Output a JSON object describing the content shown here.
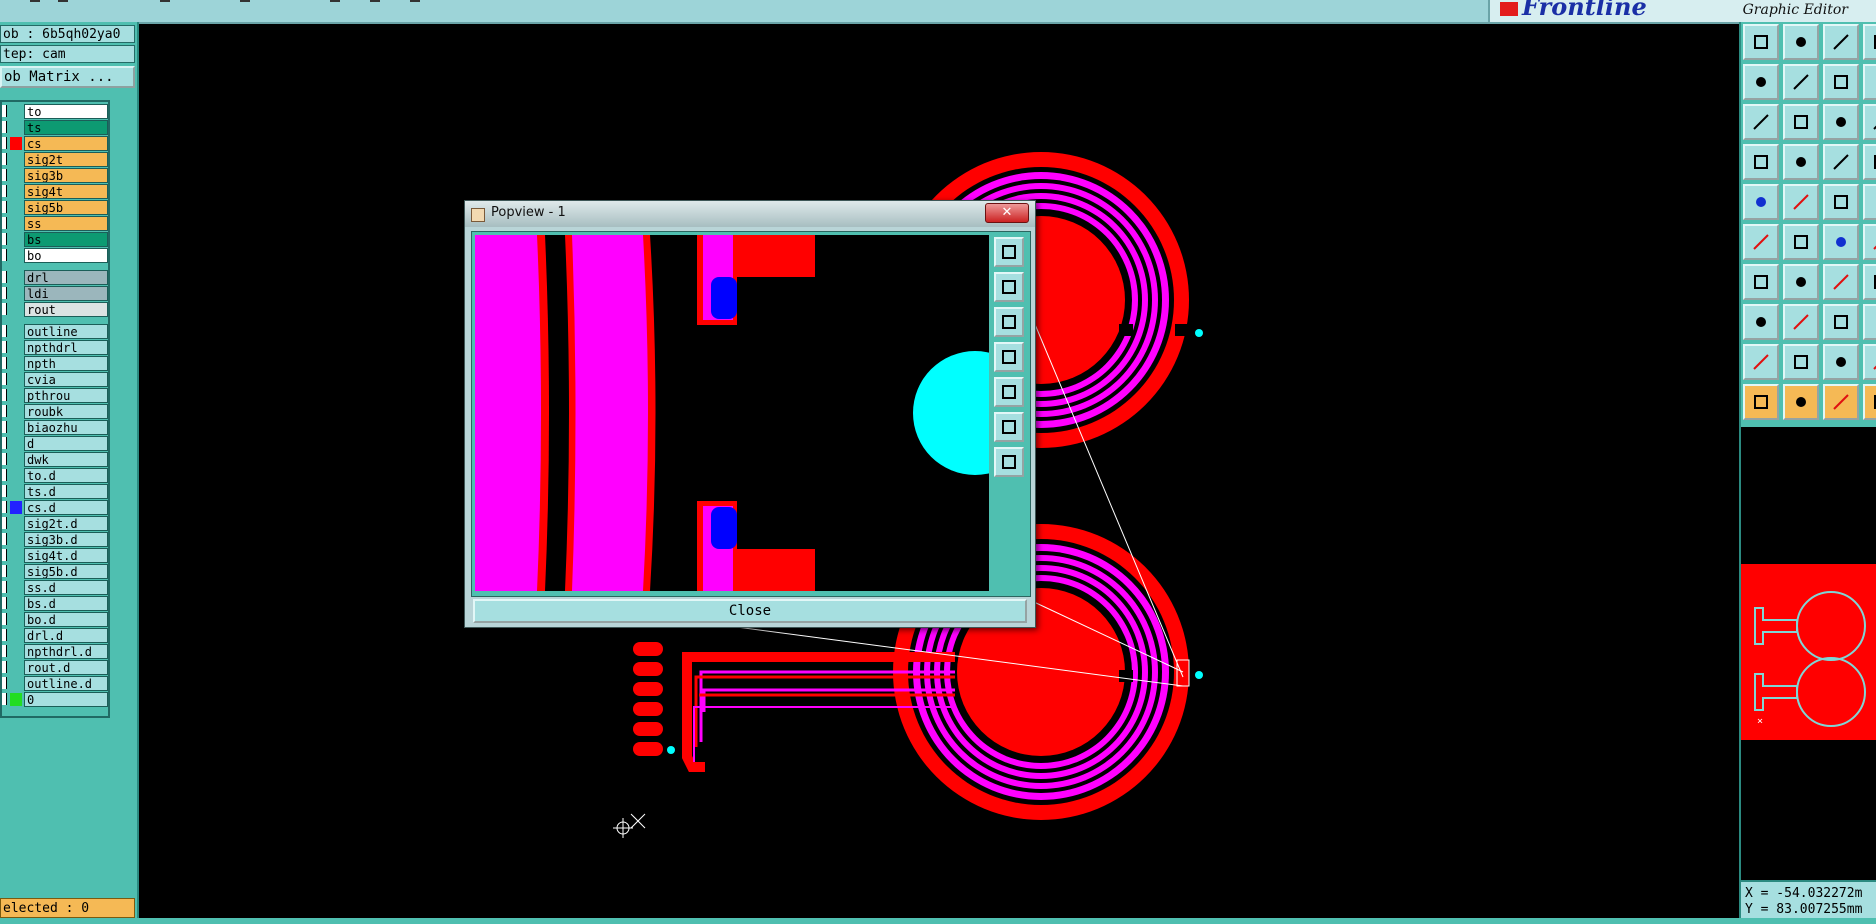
{
  "header": {
    "logo_text": "Frontline",
    "logo_subtitle": "Graphic Editor"
  },
  "left_panel": {
    "job_label": "ob : 6b5qh02ya0",
    "step_label": "tep: cam",
    "matrix_button": "ob Matrix ...",
    "layers": [
      {
        "name": "to",
        "color": "#ffffff"
      },
      {
        "name": "ts",
        "color": "#0d9a72"
      },
      {
        "name": "cs",
        "color": "#f5b955",
        "swatch": "#ff0000"
      },
      {
        "name": "sig2t",
        "color": "#f5b955"
      },
      {
        "name": "sig3b",
        "color": "#f5b955"
      },
      {
        "name": "sig4t",
        "color": "#f5b955"
      },
      {
        "name": "sig5b",
        "color": "#f5b955"
      },
      {
        "name": "ss",
        "color": "#f5b955"
      },
      {
        "name": "bs",
        "color": "#0d9a72"
      },
      {
        "name": "bo",
        "color": "#ffffff"
      },
      {
        "name": "drl",
        "color": "#9bb6bc"
      },
      {
        "name": "ldi",
        "color": "#9bb6bc"
      },
      {
        "name": "rout",
        "color": "#dbe3e3"
      },
      {
        "name": "outline",
        "color": "#a6dfe0"
      },
      {
        "name": "npthdrl",
        "color": "#a6dfe0"
      },
      {
        "name": "npth",
        "color": "#a6dfe0"
      },
      {
        "name": "cvia",
        "color": "#a6dfe0"
      },
      {
        "name": "pthrou",
        "color": "#a6dfe0"
      },
      {
        "name": "roubk",
        "color": "#a6dfe0"
      },
      {
        "name": "biaozhu",
        "color": "#a6dfe0"
      },
      {
        "name": "d",
        "color": "#a6dfe0"
      },
      {
        "name": "dwk",
        "color": "#a6dfe0"
      },
      {
        "name": "to.d",
        "color": "#a6dfe0"
      },
      {
        "name": "ts.d",
        "color": "#a6dfe0"
      },
      {
        "name": "cs.d",
        "color": "#a6dfe0",
        "swatch": "#2222ff"
      },
      {
        "name": "sig2t.d",
        "color": "#a6dfe0"
      },
      {
        "name": "sig3b.d",
        "color": "#a6dfe0"
      },
      {
        "name": "sig4t.d",
        "color": "#a6dfe0"
      },
      {
        "name": "sig5b.d",
        "color": "#a6dfe0"
      },
      {
        "name": "ss.d",
        "color": "#a6dfe0"
      },
      {
        "name": "bs.d",
        "color": "#a6dfe0"
      },
      {
        "name": "bo.d",
        "color": "#a6dfe0"
      },
      {
        "name": "drl.d",
        "color": "#a6dfe0"
      },
      {
        "name": "npthdrl.d",
        "color": "#a6dfe0"
      },
      {
        "name": "rout.d",
        "color": "#a6dfe0"
      },
      {
        "name": "outline.d",
        "color": "#a6dfe0"
      },
      {
        "name": "0",
        "color": "#a6dfe0",
        "swatch": "#22dd22"
      }
    ],
    "selected_status": "elected : 0"
  },
  "popview": {
    "title": "Popview - 1",
    "title_close": "✕",
    "close_button": "Close"
  },
  "status": {
    "x_readout": "X = -54.032272m",
    "y_readout": "Y = 83.007255mm"
  },
  "colors": {
    "panel_teal": "#4fbfb0",
    "light_teal": "#a6dfe0",
    "copper_red": "#ff0000",
    "mask_magenta": "#ff00ff",
    "highlight_cyan": "#00ffff",
    "layer_orange": "#f5b955"
  }
}
